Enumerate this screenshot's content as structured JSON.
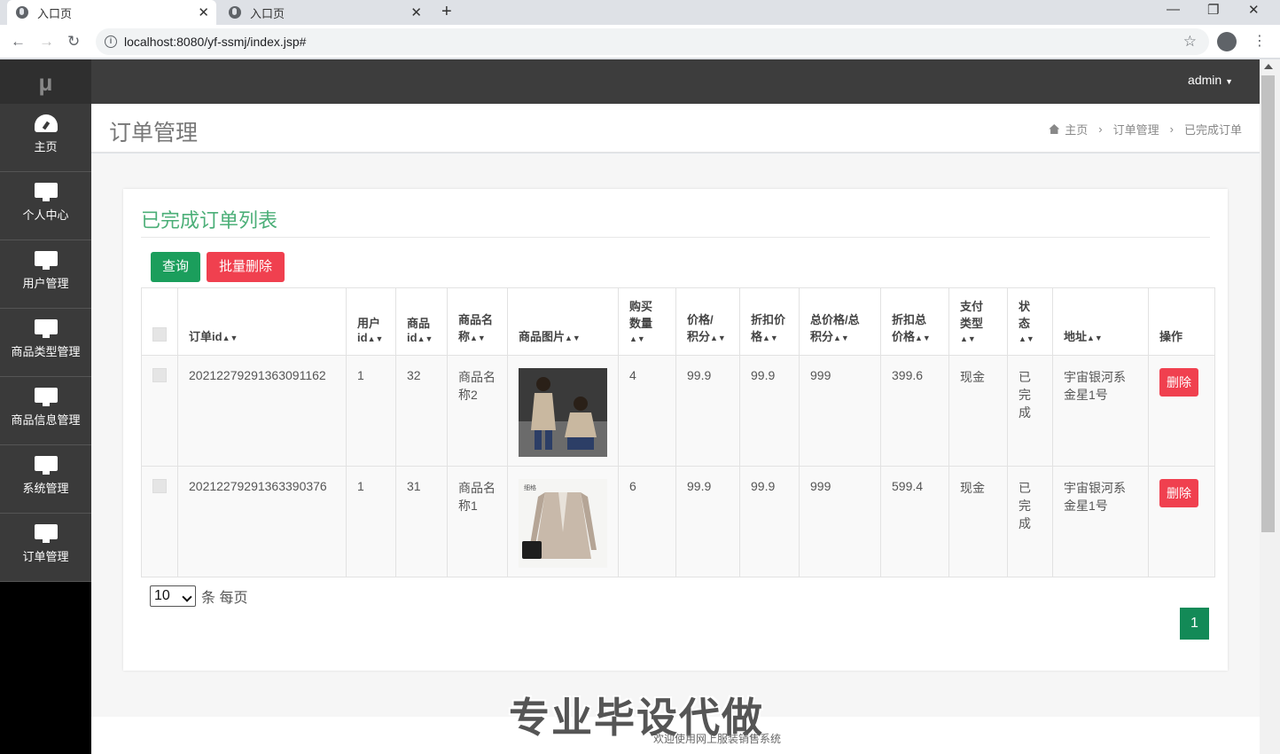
{
  "browser": {
    "tabs": [
      {
        "title": "入口页"
      },
      {
        "title": "入口页"
      }
    ],
    "url": "localhost:8080/yf-ssmj/index.jsp#"
  },
  "app": {
    "logo": "μ",
    "user": "admin",
    "sidebar": [
      {
        "label": "主页",
        "icon": "dashboard-icon"
      },
      {
        "label": "个人中心",
        "icon": "monitor-icon"
      },
      {
        "label": "用户管理",
        "icon": "monitor-icon"
      },
      {
        "label": "商品类型管理",
        "icon": "monitor-icon"
      },
      {
        "label": "商品信息管理",
        "icon": "monitor-icon"
      },
      {
        "label": "系统管理",
        "icon": "monitor-icon"
      },
      {
        "label": "订单管理",
        "icon": "monitor-icon"
      }
    ],
    "page_title": "订单管理",
    "breadcrumb": [
      "主页",
      "订单管理",
      "已完成订单"
    ]
  },
  "card": {
    "title": "已完成订单列表",
    "query_btn": "查询",
    "batch_delete_btn": "批量删除"
  },
  "table": {
    "headers": {
      "order_id": "订单id",
      "user_id_1": "用户",
      "user_id_2": "id",
      "goods_id_1": "商品",
      "goods_id_2": "id",
      "goods_name_1": "商品名",
      "goods_name_2": "称",
      "goods_img": "商品图片",
      "qty_1": "购买",
      "qty_2": "数量",
      "price_1": "价格/",
      "price_2": "积分",
      "discount_1": "折扣价",
      "discount_2": "格",
      "total_1": "总价格/总",
      "total_2": "积分",
      "disc_total_1": "折扣总",
      "disc_total_2": "价格",
      "pay_1": "支付",
      "pay_2": "类型",
      "status_1": "状",
      "status_2": "态",
      "address": "地址",
      "action": "操作"
    },
    "rows": [
      {
        "order_id": "20212279291363091162",
        "user_id": "1",
        "goods_id": "32",
        "goods_name_1": "商品名",
        "goods_name_2": "称2",
        "qty": "4",
        "price": "99.9",
        "discount": "99.9",
        "total": "999",
        "disc_total": "399.6",
        "pay": "现金",
        "status_1": "已",
        "status_2": "完",
        "status_3": "成",
        "address_1": "宇宙银河系",
        "address_2": "金星1号",
        "delete": "删除"
      },
      {
        "order_id": "20212279291363390376",
        "user_id": "1",
        "goods_id": "31",
        "goods_name_1": "商品名",
        "goods_name_2": "称1",
        "qty": "6",
        "price": "99.9",
        "discount": "99.9",
        "total": "999",
        "disc_total": "599.4",
        "pay": "现金",
        "status_1": "已",
        "status_2": "完",
        "status_3": "成",
        "address_1": "宇宙银河系",
        "address_2": "金星1号",
        "delete": "删除"
      }
    ]
  },
  "pagination": {
    "page_size": "10",
    "per_page_text": "条 每页",
    "current_page": "1"
  },
  "footer": {
    "watermark": "专业毕设代做",
    "text": "欢迎使用网上服装销售系统"
  }
}
